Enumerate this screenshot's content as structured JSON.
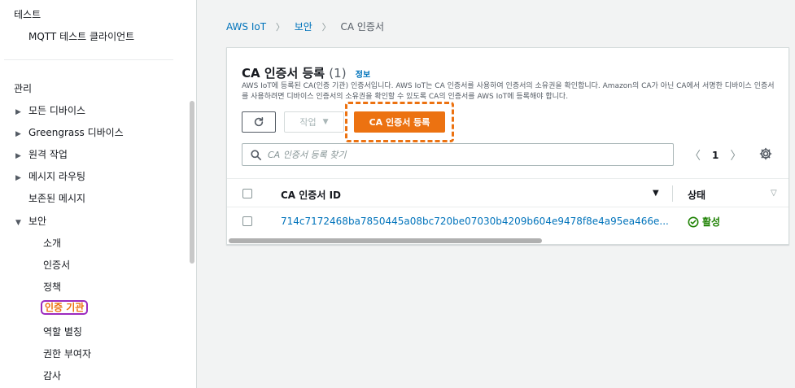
{
  "sidebar": {
    "test_header": "테스트",
    "test_items": [
      "MQTT 테스트 클라이언트"
    ],
    "manage_header": "관리",
    "manage_items": [
      {
        "label": "모든 디바이스",
        "expandable": true
      },
      {
        "label": "Greengrass 디바이스",
        "expandable": true
      },
      {
        "label": "원격 작업",
        "expandable": true
      },
      {
        "label": "메시지 라우팅",
        "expandable": true
      },
      {
        "label": "보존된 메시지",
        "expandable": false
      }
    ],
    "security_label": "보안",
    "security_items": [
      "소개",
      "인증서",
      "정책",
      "인증 기관",
      "역할 별칭",
      "권한 부여자",
      "감사"
    ],
    "active_item": "인증 기관"
  },
  "breadcrumb": {
    "items": [
      "AWS IoT",
      "보안",
      "CA 인증서"
    ]
  },
  "panel": {
    "title": "CA 인증서 등록",
    "count": "(1)",
    "info_link": "정보",
    "description": "AWS IoT에 등록된 CA(인증 기관) 인증서입니다. AWS IoT는 CA 인증서를 사용하여 인증서의 소유권을 확인합니다. Amazon의 CA가 아닌 CA에서 서명한 디바이스 인증서를 사용하려면 디바이스 인증서의 소유권을 확인할 수 있도록 CA의 인증서를 AWS IoT에 등록해야 합니다.",
    "action_label": "작업",
    "primary_label": "CA 인증서 등록",
    "search_placeholder": "CA 인증서 등록 찾기",
    "page_number": "1"
  },
  "table": {
    "columns": [
      "CA 인증서 ID",
      "상태"
    ],
    "rows": [
      {
        "id": "714c7172468ba7850445a08bc720be07030b4209b604e9478f8e4a95ea466e...",
        "status": "활성"
      }
    ]
  },
  "colors": {
    "accent": "#ec7211",
    "link": "#0073bb",
    "success": "#1d8102",
    "highlight": "#9c2abf"
  }
}
